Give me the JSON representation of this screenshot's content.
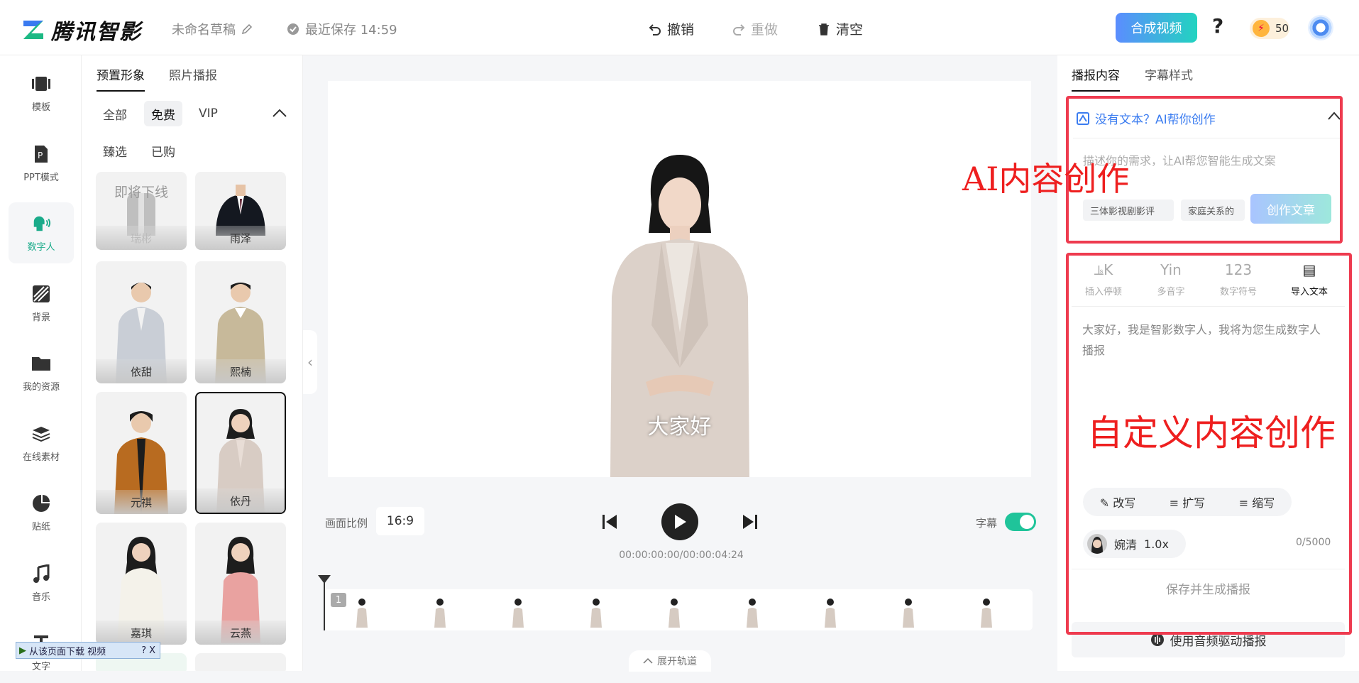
{
  "header": {
    "brand": "腾讯智影",
    "draft_name": "未命名草稿",
    "saved_status": "最近保存 14:59",
    "undo_label": "撤销",
    "redo_label": "重做",
    "clear_label": "清空",
    "compose_label": "合成视频",
    "help_label": "?",
    "coins_count": "50"
  },
  "nav": {
    "items": [
      {
        "label": "模板",
        "icon": "template-icon"
      },
      {
        "label": "PPT模式",
        "icon": "ppt-icon"
      },
      {
        "label": "数字人",
        "icon": "digital-human-icon"
      },
      {
        "label": "背景",
        "icon": "background-icon"
      },
      {
        "label": "我的资源",
        "icon": "folder-icon"
      },
      {
        "label": "在线素材",
        "icon": "layers-icon"
      },
      {
        "label": "贴纸",
        "icon": "sticker-icon"
      },
      {
        "label": "音乐",
        "icon": "music-icon"
      },
      {
        "label": "文字",
        "icon": "text-icon"
      }
    ],
    "active_index": 2
  },
  "panel": {
    "tabs": [
      "预置形象",
      "照片播报"
    ],
    "filters": [
      "全部",
      "免费",
      "VIP"
    ],
    "filters2": [
      "臻选",
      "已购"
    ],
    "offline_notice": "即将下线",
    "avatars": [
      {
        "name": "瑞彬"
      },
      {
        "name": "雨泽"
      },
      {
        "name": "依甜"
      },
      {
        "name": "熙楠"
      },
      {
        "name": "元祺"
      },
      {
        "name": "依丹"
      },
      {
        "name": "嘉琪"
      },
      {
        "name": "云燕"
      }
    ],
    "selected_avatar": "依丹"
  },
  "preview": {
    "subtitle_text": "大家好",
    "ratio_label": "画面比例",
    "ratio_value": "16:9",
    "subtitle_toggle_label": "字幕",
    "timecode": "00:00:00:00/00:00:04:24",
    "track_number": "1",
    "expand_label": "展开轨道"
  },
  "right": {
    "tabs": [
      "播报内容",
      "字幕样式"
    ],
    "ai_header": "没有文本？AI帮你创作",
    "ai_placeholder": "描述你的需求，让AI帮您智能生成文案",
    "ai_tags": [
      "三体影视剧影评",
      "家庭关系的"
    ],
    "ai_create_label": "创作文章",
    "tools": [
      {
        "glyph": "⫡K",
        "label": "插入停顿"
      },
      {
        "glyph": "Yin",
        "label": "多音字"
      },
      {
        "glyph": "123",
        "label": "数字符号"
      },
      {
        "glyph": "▤",
        "label": "导入文本"
      }
    ],
    "script_text": "大家好，我是智影数字人，我将为您生成数字人播报",
    "rewrite_label": "改写",
    "expand_label": "扩写",
    "shorten_label": "缩写",
    "voice_name": "婉清",
    "voice_speed": "1.0x",
    "char_count": "0/5000",
    "save_generate_label": "保存并生成播报",
    "audio_drive_label": "使用音频驱动播报"
  },
  "annotations": {
    "ai_label": "AI内容创作",
    "custom_label": "自定义内容创作",
    "color": "#ee1f1f"
  },
  "download_bar": {
    "label": "从该页面下载 视频",
    "help": "?",
    "close": "X"
  },
  "colors": {
    "accent": "#1aab8a",
    "link": "#3b7cf0",
    "highlight": "#ee3b4f"
  }
}
